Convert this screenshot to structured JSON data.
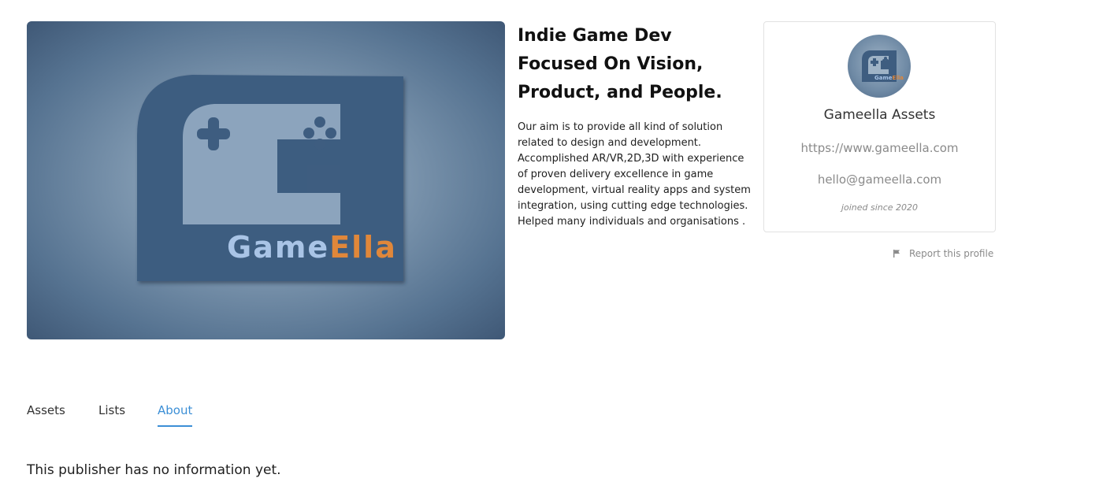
{
  "publisher": {
    "banner": {
      "logo_text_part1": "Game",
      "logo_text_part2": "Ella",
      "logo_color_part1": "#a9c4e6",
      "logo_color_part2": "#e0873a"
    },
    "headline": "Indie Game Dev Focused On Vision, Product, and People.",
    "description": "Our aim is to provide all kind of solution related to design and development. Accomplished AR/VR,2D,3D with experience of proven delivery excellence in game development, virtual reality apps and system integration, using cutting edge technologies. Helped many individuals and organisations ."
  },
  "card": {
    "name": "Gameella Assets",
    "website": "https://www.gameella.com",
    "email": "hello@gameella.com",
    "joined": "joined since 2020",
    "avatar_text_part1": "Game",
    "avatar_text_part2": "Ella"
  },
  "report": {
    "label": "Report this profile",
    "icon": "flag-icon"
  },
  "tabs": [
    {
      "label": "Assets",
      "active": false
    },
    {
      "label": "Lists",
      "active": false
    },
    {
      "label": "About",
      "active": true
    }
  ],
  "about": {
    "empty_message": "This publisher has no information yet."
  },
  "colors": {
    "accent": "#3c8fd6",
    "muted_text": "#8a8a8a"
  }
}
